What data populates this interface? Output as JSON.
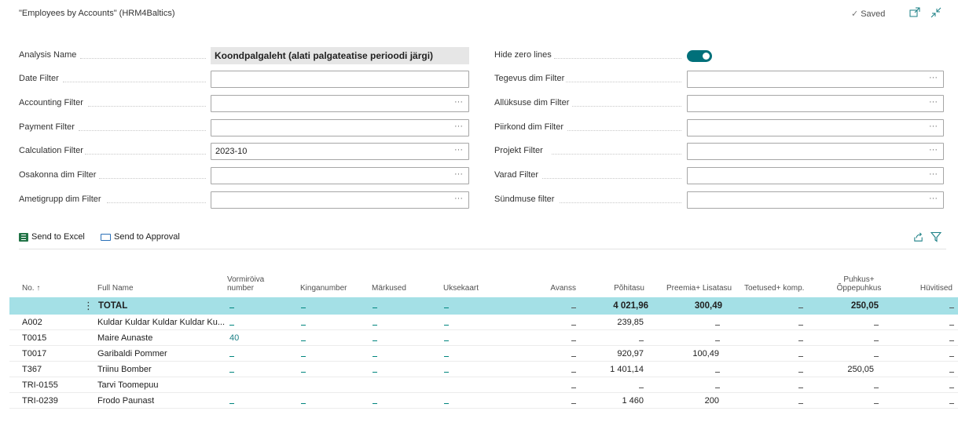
{
  "page": {
    "title": "\"Employees by Accounts\" (HRM4Baltics)",
    "saved_label": "Saved"
  },
  "filters_left": [
    {
      "label": "Analysis Name",
      "value": "Koondpalgaleht (alati palgateatise perioodi järgi)",
      "kind": "readonly"
    },
    {
      "label": "Date Filter",
      "value": "",
      "kind": "text"
    },
    {
      "label": "Accounting Filter",
      "value": "",
      "kind": "lookup"
    },
    {
      "label": "Payment Filter",
      "value": "",
      "kind": "lookup"
    },
    {
      "label": "Calculation Filter",
      "value": "2023-10",
      "kind": "lookup"
    },
    {
      "label": "Osakonna dim Filter",
      "value": "",
      "kind": "lookup"
    },
    {
      "label": "Ametigrupp dim Filter",
      "value": "",
      "kind": "lookup"
    }
  ],
  "filters_right": [
    {
      "label": "Hide zero lines",
      "value": "",
      "kind": "toggle",
      "checked": true
    },
    {
      "label": "Tegevus dim Filter",
      "value": "",
      "kind": "lookup"
    },
    {
      "label": "Allüksuse dim Filter",
      "value": "",
      "kind": "lookup"
    },
    {
      "label": "Piirkond dim Filter",
      "value": "",
      "kind": "lookup"
    },
    {
      "label": "Projekt Filter",
      "value": "",
      "kind": "lookup"
    },
    {
      "label": "Varad Filter",
      "value": "",
      "kind": "lookup"
    },
    {
      "label": "Sündmuse filter",
      "value": "",
      "kind": "lookup"
    }
  ],
  "actions": {
    "send_to_excel": "Send to Excel",
    "send_to_approval": "Send to Approval"
  },
  "grid": {
    "headers": [
      "No. ↑",
      "Full Name",
      "Vormiröiva number",
      "Kinganumber",
      "Märkused",
      "Uksekaart",
      "Avanss",
      "Põhitasu",
      "Preemia+ Lisatasu",
      "Toetused+ komp.",
      "Puhkus+ Õppepuhkus",
      "Hüvitised"
    ],
    "total_label": "TOTAL",
    "total": {
      "pohitasu": "4 021,96",
      "preemia": "300,49",
      "puhkus": "250,05"
    },
    "rows": [
      {
        "no": "A002",
        "name": "Kuldar Kuldar Kuldar Kuldar Ku...",
        "vormi": "",
        "pohitasu": "239,85",
        "preemia": "",
        "puhkus": ""
      },
      {
        "no": "T0015",
        "name": "Maire Aunaste",
        "vormi": "40",
        "pohitasu": "",
        "preemia": "",
        "puhkus": ""
      },
      {
        "no": "T0017",
        "name": "Garibaldi Pommer",
        "vormi": "",
        "pohitasu": "920,97",
        "preemia": "100,49",
        "puhkus": ""
      },
      {
        "no": "T367",
        "name": "Triinu Bomber",
        "vormi": "",
        "pohitasu": "1 401,14",
        "preemia": "",
        "puhkus": "250,05"
      },
      {
        "no": "TRI-0155",
        "name": "Tarvi Toomepuu",
        "vormi": "",
        "pohitasu": "",
        "preemia": "",
        "puhkus": "",
        "blank": true
      },
      {
        "no": "TRI-0239",
        "name": "Frodo Paunast",
        "vormi": "",
        "pohitasu": "1 460",
        "preemia": "200",
        "puhkus": ""
      }
    ]
  },
  "colors": {
    "accent": "#00707a",
    "total_row": "#a4e0e6",
    "link": "#1a7f85"
  }
}
